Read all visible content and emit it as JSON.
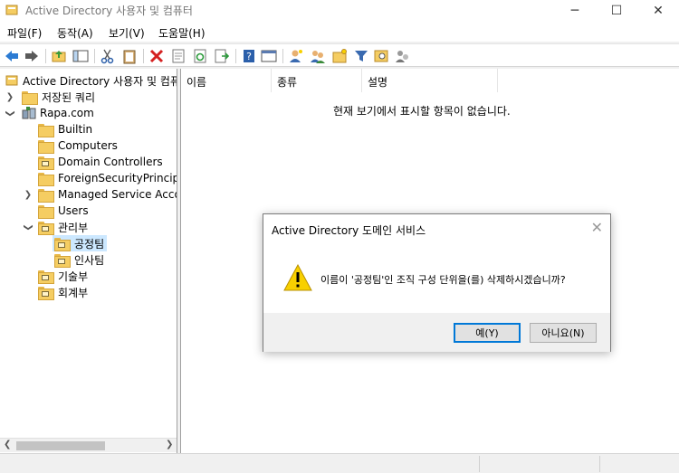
{
  "window": {
    "title": "Active Directory 사용자 및 컴퓨터",
    "minimize": "─",
    "maximize": "☐",
    "close": "✕"
  },
  "menu": {
    "file": "파일(F)",
    "action": "동작(A)",
    "view": "보기(V)",
    "help": "도움말(H)"
  },
  "tree": {
    "root": "Active Directory 사용자 및 컴퓨터",
    "saved_queries": "저장된 쿼리",
    "domain": "Rapa.com",
    "builtin": "Builtin",
    "computers": "Computers",
    "domain_controllers": "Domain Controllers",
    "foreign": "ForeignSecurityPrincipals",
    "managed": "Managed Service Accounts",
    "users": "Users",
    "mgmt": "관리부",
    "production": "공정팀",
    "hr": "인사팀",
    "tech": "기술부",
    "accounting": "회계부"
  },
  "content": {
    "col_name": "이름",
    "col_type": "종류",
    "col_desc": "설명",
    "empty": "현재 보기에서 표시할 항목이 없습니다."
  },
  "dialog": {
    "title": "Active Directory 도메인 서비스",
    "close": "✕",
    "message": "이름이 '공정팀'인 조직 구성 단위을(를) 삭제하시겠습니까?",
    "yes": "예(Y)",
    "no": "아니요(N)"
  },
  "colors": {
    "accent": "#0078d7",
    "folder": "#f5cd62",
    "selection": "#cce8ff",
    "warning": "#f8d000"
  }
}
